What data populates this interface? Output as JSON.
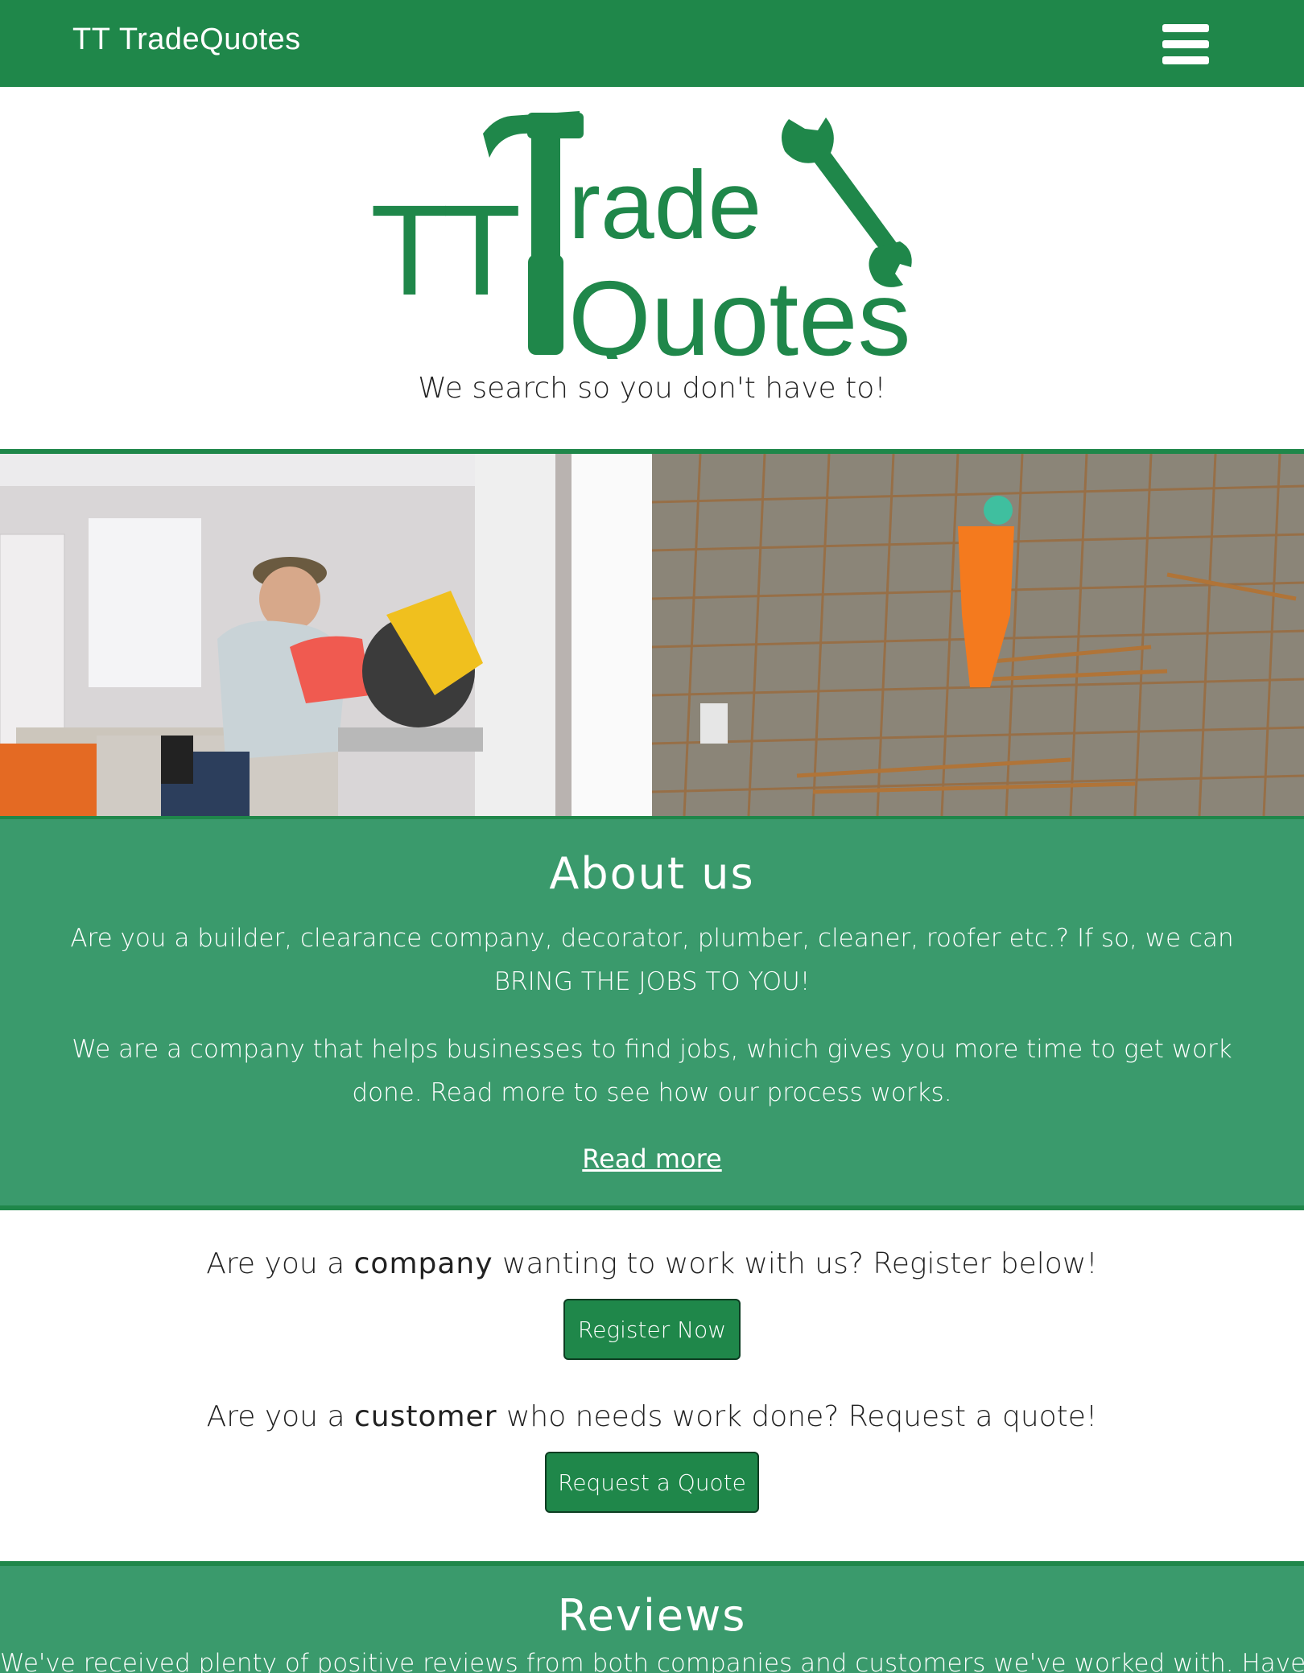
{
  "navbar": {
    "brand_prefix": "TT",
    "brand_name": "TradeQuotes",
    "menu_icon": "hamburger-menu-icon"
  },
  "logo": {
    "line1_prefix": "TT",
    "line1_word": "rade",
    "line2_word": "Quotes",
    "hammer_icon": "hammer-icon",
    "wrench_icon": "wrench-icon"
  },
  "tagline": "We search so you don't have to!",
  "hero": {
    "left_image": "carpenters-mitre-saw-photo",
    "right_image": "construction-worker-rebar-photo"
  },
  "about": {
    "title": "About us",
    "paragraph1": "Are you a builder, clearance company, decorator, plumber, cleaner, roofer etc.? If so, we can BRING THE JOBS TO YOU!",
    "paragraph2": "We are a company that helps businesses to find jobs, which gives you more time to get work done. Read more to see how our process works.",
    "link": "Read more"
  },
  "cta": {
    "company_pre": "Are you a",
    "company_word": "company",
    "company_post": "wanting to work with us? Register below!",
    "register_button": "Register Now",
    "customer_pre": "Are you a",
    "customer_word": "customer",
    "customer_post": "who needs work done? Request a quote!",
    "quote_button": "Request a Quote"
  },
  "reviews": {
    "title": "Reviews",
    "text": "We've received plenty of positive reviews from both companies and customers we've worked with. Have a"
  },
  "colors": {
    "brand_green": "#1f874a",
    "section_green": "#3a9a6c",
    "button_border": "#0d3d22"
  }
}
